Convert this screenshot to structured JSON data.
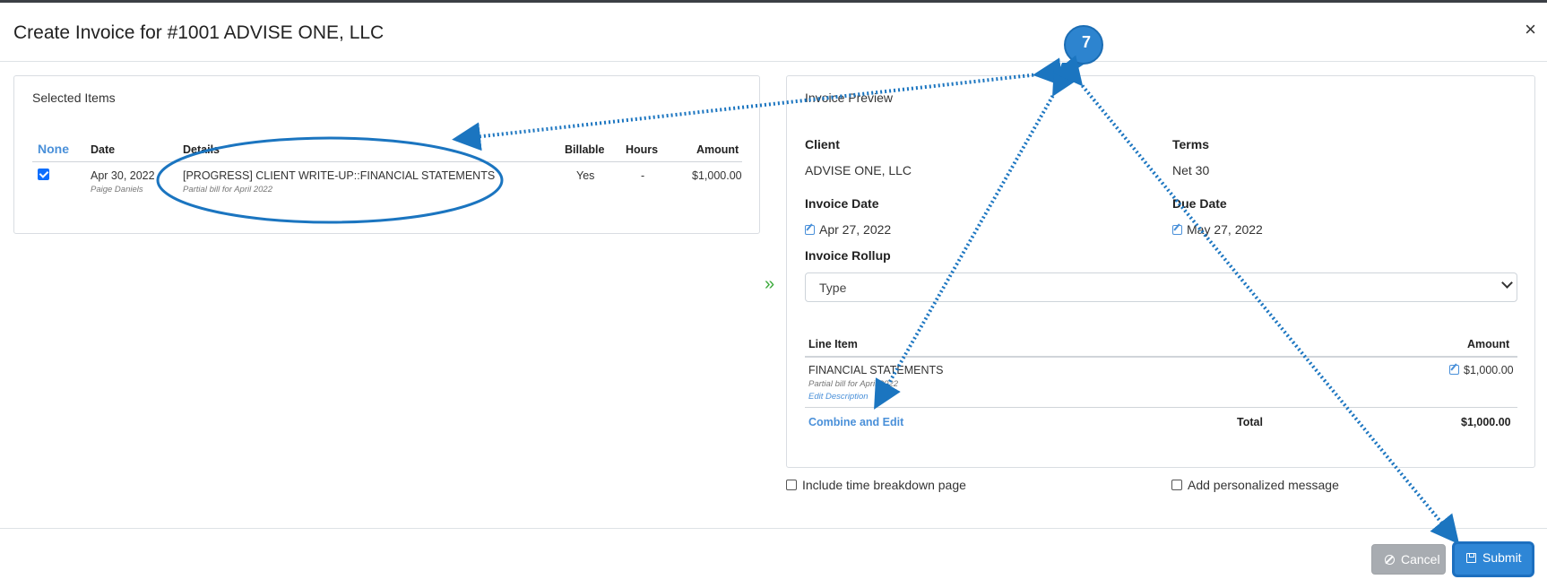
{
  "modal": {
    "title": "Create Invoice for #1001 ADVISE ONE, LLC",
    "close_glyph": "×"
  },
  "selected_items": {
    "title": "Selected Items",
    "select_toggle": "None",
    "columns": [
      "Date",
      "Details",
      "Billable",
      "Hours",
      "Amount"
    ],
    "rows": [
      {
        "checked": true,
        "date": "Apr 30, 2022",
        "staff": "Paige Daniels",
        "details": "[PROGRESS] CLIENT WRITE-UP::FINANCIAL STATEMENTS",
        "note": "Partial bill for April 2022",
        "billable": "Yes",
        "hours": "-",
        "amount": "$1,000.00"
      }
    ]
  },
  "transfer_icon": "»",
  "invoice_preview": {
    "title": "Invoice Preview",
    "client_label": "Client",
    "client_value": "ADVISE ONE, LLC",
    "terms_label": "Terms",
    "terms_value": "Net 30",
    "invoice_date_label": "Invoice Date",
    "invoice_date_value": "Apr 27, 2022",
    "due_date_label": "Due Date",
    "due_date_value": "May 27, 2022",
    "rollup_label": "Invoice Rollup",
    "rollup_value": "Type",
    "line_item_header": "Line Item",
    "amount_header": "Amount",
    "line_items": [
      {
        "name": "FINANCIAL STATEMENTS",
        "note": "Partial bill for April 2022",
        "edit_description": "Edit Description",
        "amount": "$1,000.00"
      }
    ],
    "combine_edit": "Combine and Edit",
    "total_label": "Total",
    "total_value": "$1,000.00"
  },
  "options": {
    "time_breakdown": "Include time breakdown page",
    "personalized_message": "Add personalized message"
  },
  "buttons": {
    "cancel": "Cancel",
    "submit": "Submit"
  },
  "annotation": {
    "step_number": "7",
    "color": "#1b75c0"
  }
}
